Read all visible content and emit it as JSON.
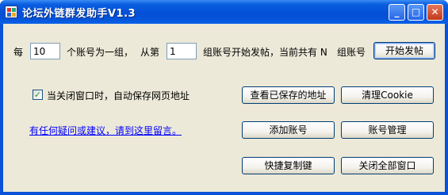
{
  "window": {
    "title": "论坛外链群发助手V1.3",
    "controls": {
      "minimize": "_",
      "maximize": "□",
      "close": "✕"
    }
  },
  "form": {
    "per_label": "每",
    "per_value": "10",
    "group_suffix": "个账号为一组，",
    "from_label": "从第",
    "from_value": "1",
    "start_info": "组账号开始发帖，当前共有 N",
    "count_label": "组账号",
    "start_button": "开始发帖"
  },
  "options": {
    "autosave_checked": true,
    "check_mark": "✓",
    "autosave_label": "当关闭窗口时，自动保存网页地址"
  },
  "feedback_link": "有任何疑问或建议，请到这里留言。",
  "buttons": {
    "view_saved": "查看已保存的地址",
    "clear_cookie": "清理Cookie",
    "add_account": "添加账号",
    "manage_account": "账号管理",
    "quick_copy": "快捷复制键",
    "close_all": "关闭全部窗口"
  },
  "colors": {
    "titlebar": "#0a52d6",
    "client": "#ece9d8",
    "link": "#0000ff"
  }
}
